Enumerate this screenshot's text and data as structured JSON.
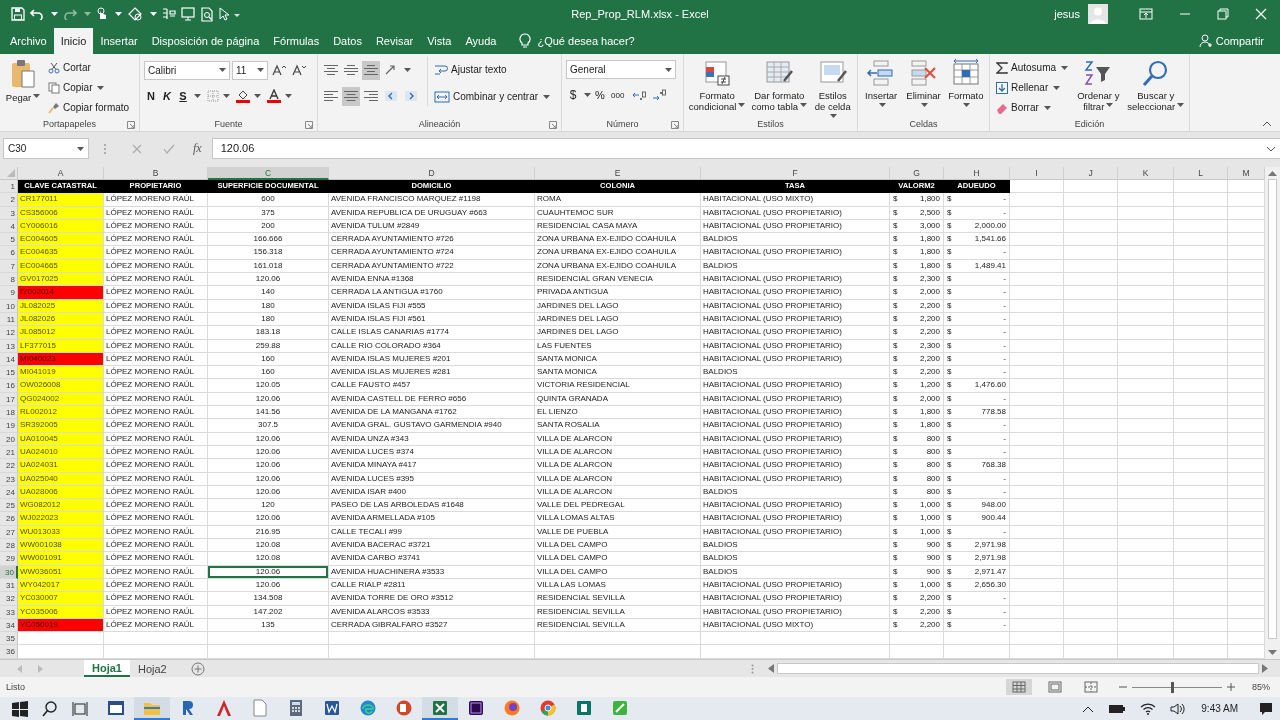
{
  "window": {
    "title": "Rep_Prop_RLM.xlsx  -  Excel",
    "user": "jesus"
  },
  "tabs": [
    {
      "label": "Archivo",
      "selected": false
    },
    {
      "label": "Inicio",
      "selected": true
    },
    {
      "label": "Insertar",
      "selected": false
    },
    {
      "label": "Disposición de página",
      "selected": false
    },
    {
      "label": "Fórmulas",
      "selected": false
    },
    {
      "label": "Datos",
      "selected": false
    },
    {
      "label": "Revisar",
      "selected": false
    },
    {
      "label": "Vista",
      "selected": false
    },
    {
      "label": "Ayuda",
      "selected": false
    }
  ],
  "tell_me": "¿Qué desea hacer?",
  "share": "Compartir",
  "ribbon": {
    "clipboard": {
      "label": "Portapapeles",
      "paste": "Pegar",
      "cut": "Cortar",
      "copy": "Copiar",
      "format_painter": "Copiar formato"
    },
    "font": {
      "label": "Fuente",
      "family": "Calibri",
      "size": "11",
      "bold": "N",
      "italic": "K",
      "underline": "S"
    },
    "alignment": {
      "label": "Alineación",
      "wrap": "Ajustar texto",
      "merge": "Combinar y centrar",
      "valign": [
        {
          "selected": false
        },
        {
          "selected": false
        },
        {
          "selected": true
        }
      ],
      "halign": [
        {
          "selected": false
        },
        {
          "selected": true
        },
        {
          "selected": false
        }
      ]
    },
    "number": {
      "label": "Número",
      "format": "General",
      "currency": "$",
      "percent": "%",
      "thousands": "000"
    },
    "styles": {
      "label": "Estilos",
      "conditional": "Formato condicional",
      "table": "Dar formato como tabla",
      "cell_styles": "Estilos de celda"
    },
    "cells": {
      "label": "Celdas",
      "insert": "Insertar",
      "delete": "Eliminar",
      "format": "Formato"
    },
    "editing": {
      "label": "Edición",
      "autosum": "Autosuma",
      "fill": "Rellenar",
      "clear": "Borrar",
      "sort": "Ordenar y filtrar",
      "find": "Buscar y seleccionar"
    }
  },
  "formula_bar": {
    "name_box": "C30",
    "function_label": "fx",
    "value": "120.06"
  },
  "sheet": {
    "columns": [
      {
        "label": "A",
        "selected": false
      },
      {
        "label": "B",
        "selected": false
      },
      {
        "label": "C",
        "selected": true
      },
      {
        "label": "D",
        "selected": false
      },
      {
        "label": "E",
        "selected": false
      },
      {
        "label": "F",
        "selected": false
      },
      {
        "label": "G",
        "selected": false
      },
      {
        "label": "H",
        "selected": false
      },
      {
        "label": "I",
        "selected": false
      },
      {
        "label": "J",
        "selected": false
      },
      {
        "label": "K",
        "selected": false
      },
      {
        "label": "L",
        "selected": false
      },
      {
        "label": "M",
        "selected": false
      }
    ],
    "header": {
      "n": "1",
      "cells": [
        "CLAVE CATASTRAL",
        "PROPIETARIO",
        "SUPERFICIE DOCUMENTAL",
        "DOMICILIO",
        "COLONIA",
        "TASA",
        "VALORM2",
        "ADUEUDO"
      ]
    },
    "rows": [
      {
        "n": "2",
        "color": "#ffff00",
        "selected": false,
        "cells": [
          "CR177011",
          "LÓPEZ MORENO RAÚL",
          "600",
          "AVENIDA FRANCISCO MARQUEZ #1198",
          "ROMA",
          "HABITACIONAL (USO MIXTO)"
        ],
        "valor": [
          "$",
          "1,800"
        ],
        "adeudo": [
          "$",
          "-"
        ]
      },
      {
        "n": "3",
        "color": "#ffff00",
        "selected": false,
        "cells": [
          "CS356006",
          "LÓPEZ MORENO RAÚL",
          "375",
          "AVENIDA REPUBLICA DE URUGUAY #663",
          "CUAUHTEMOC SUR",
          "HABITACIONAL (USO PROPIETARIO)"
        ],
        "valor": [
          "$",
          "2,500"
        ],
        "adeudo": [
          "$",
          "-"
        ]
      },
      {
        "n": "4",
        "color": "#ffff00",
        "selected": false,
        "cells": [
          "CY006016",
          "LÓPEZ MORENO RAÚL",
          "200",
          "AVENIDA TULUM #2849",
          "RESIDENCIAL CASA MAYA",
          "HABITACIONAL (USO PROPIETARIO)"
        ],
        "valor": [
          "$",
          "3,000"
        ],
        "adeudo": [
          "$",
          "2,000.00"
        ]
      },
      {
        "n": "5",
        "color": "#ffff00",
        "selected": false,
        "cells": [
          "EC004605",
          "LÓPEZ MORENO RAÚL",
          "166.666",
          "CERRADA AYUNTAMIENTO #726",
          "ZONA URBANA EX-EJIDO COAHUILA",
          "BALDIOS"
        ],
        "valor": [
          "$",
          "1,800"
        ],
        "adeudo": [
          "$",
          "1,541.66"
        ]
      },
      {
        "n": "6",
        "color": "#ffff00",
        "selected": false,
        "cells": [
          "EC004635",
          "LÓPEZ MORENO RAÚL",
          "156.318",
          "CERRADA AYUNTAMIENTO #724",
          "ZONA URBANA EX-EJIDO COAHUILA",
          "HABITACIONAL (USO PROPIETARIO)"
        ],
        "valor": [
          "$",
          "1,800"
        ],
        "adeudo": [
          "$",
          "-"
        ]
      },
      {
        "n": "7",
        "color": "#ffff00",
        "selected": false,
        "cells": [
          "EC004665",
          "LÓPEZ MORENO RAÚL",
          "161.018",
          "CERRADA AYUNTAMIENTO #722",
          "ZONA URBANA EX-EJIDO COAHUILA",
          "BALDIOS"
        ],
        "valor": [
          "$",
          "1,800"
        ],
        "adeudo": [
          "$",
          "1,489.41"
        ]
      },
      {
        "n": "8",
        "color": "#ffff00",
        "selected": false,
        "cells": [
          "GV017025",
          "LÓPEZ MORENO RAÚL",
          "120.06",
          "AVENIDA ENNA #1368",
          "RESIDENCIAL GRAN VENECIA",
          "HABITACIONAL (USO PROPIETARIO)"
        ],
        "valor": [
          "$",
          "2,300"
        ],
        "adeudo": [
          "$",
          "-"
        ]
      },
      {
        "n": "9",
        "color": "#ff0000",
        "selected": false,
        "cells": [
          "IY002014",
          "LÓPEZ MORENO RAÚL",
          "140",
          "CERRADA LA ANTIGUA #1760",
          "PRIVADA ANTIGUA",
          "HABITACIONAL (USO PROPIETARIO)"
        ],
        "valor": [
          "$",
          "2,000"
        ],
        "adeudo": [
          "$",
          "-"
        ]
      },
      {
        "n": "10",
        "color": "#ffff00",
        "selected": false,
        "cells": [
          "JL082025",
          "LÓPEZ MORENO RAÚL",
          "180",
          "AVENIDA ISLAS FIJI #555",
          "JARDINES DEL LAGO",
          "HABITACIONAL (USO PROPIETARIO)"
        ],
        "valor": [
          "$",
          "2,200"
        ],
        "adeudo": [
          "$",
          "-"
        ]
      },
      {
        "n": "11",
        "color": "#ffff00",
        "selected": false,
        "cells": [
          "JL082026",
          "LÓPEZ MORENO RAÚL",
          "180",
          "AVENIDA ISLAS FIJI #561",
          "JARDINES DEL LAGO",
          "HABITACIONAL (USO PROPIETARIO)"
        ],
        "valor": [
          "$",
          "2,200"
        ],
        "adeudo": [
          "$",
          "-"
        ]
      },
      {
        "n": "12",
        "color": "#ffff00",
        "selected": false,
        "cells": [
          "JL085012",
          "LÓPEZ MORENO RAÚL",
          "183.18",
          "CALLE ISLAS CANARIAS #1774",
          "JARDINES DEL LAGO",
          "HABITACIONAL (USO PROPIETARIO)"
        ],
        "valor": [
          "$",
          "2,200"
        ],
        "adeudo": [
          "$",
          "-"
        ]
      },
      {
        "n": "13",
        "color": "#ffff00",
        "selected": false,
        "cells": [
          "LF377015",
          "LÓPEZ MORENO RAÚL",
          "259.88",
          "CALLE RIO COLORADO #364",
          "LAS FUENTES",
          "HABITACIONAL (USO PROPIETARIO)"
        ],
        "valor": [
          "$",
          "2,300"
        ],
        "adeudo": [
          "$",
          "-"
        ]
      },
      {
        "n": "14",
        "color": "#ff0000",
        "selected": false,
        "cells": [
          "MI040023",
          "LÓPEZ MORENO RAÚL",
          "160",
          "AVENIDA ISLAS MUJERES #201",
          "SANTA MONICA",
          "HABITACIONAL (USO PROPIETARIO)"
        ],
        "valor": [
          "$",
          "2,200"
        ],
        "adeudo": [
          "$",
          "-"
        ]
      },
      {
        "n": "15",
        "color": "#ffff00",
        "selected": false,
        "cells": [
          "MI041019",
          "LÓPEZ MORENO RAÚL",
          "160",
          "AVENIDA ISLAS MUJERES #281",
          "SANTA MONICA",
          "BALDIOS"
        ],
        "valor": [
          "$",
          "2,200"
        ],
        "adeudo": [
          "$",
          "-"
        ]
      },
      {
        "n": "16",
        "color": "#ffff00",
        "selected": false,
        "cells": [
          "OW026008",
          "LÓPEZ MORENO RAÚL",
          "120.05",
          "CALLE FAUSTO #457",
          "VICTORIA RESIDENCIAL",
          "HABITACIONAL (USO PROPIETARIO)"
        ],
        "valor": [
          "$",
          "1,200"
        ],
        "adeudo": [
          "$",
          "1,476.60"
        ]
      },
      {
        "n": "17",
        "color": "#ffff00",
        "selected": false,
        "cells": [
          "QG024002",
          "LÓPEZ MORENO RAÚL",
          "120.06",
          "AVENIDA CASTELL DE FERRO #656",
          "QUINTA GRANADA",
          "HABITACIONAL (USO PROPIETARIO)"
        ],
        "valor": [
          "$",
          "2,000"
        ],
        "adeudo": [
          "$",
          "-"
        ]
      },
      {
        "n": "18",
        "color": "#ffff00",
        "selected": false,
        "cells": [
          "RL002012",
          "LÓPEZ MORENO RAÚL",
          "141.56",
          "AVENIDA DE LA MANGANA #1762",
          "EL LIENZO",
          "HABITACIONAL (USO PROPIETARIO)"
        ],
        "valor": [
          "$",
          "1,800"
        ],
        "adeudo": [
          "$",
          "778.58"
        ]
      },
      {
        "n": "19",
        "color": "#ffff00",
        "selected": false,
        "cells": [
          "SR392005",
          "LÓPEZ MORENO RAÚL",
          "307.5",
          "AVENIDA GRAL. GUSTAVO GARMENDIA #940",
          "SANTA ROSALIA",
          "HABITACIONAL (USO PROPIETARIO)"
        ],
        "valor": [
          "$",
          "1,800"
        ],
        "adeudo": [
          "$",
          "-"
        ]
      },
      {
        "n": "20",
        "color": "#ffff00",
        "selected": false,
        "cells": [
          "UA010045",
          "LÓPEZ MORENO RAÚL",
          "120.06",
          "AVENIDA UNZA #343",
          "VILLA DE ALARCON",
          "HABITACIONAL (USO PROPIETARIO)"
        ],
        "valor": [
          "$",
          "800"
        ],
        "adeudo": [
          "$",
          "-"
        ]
      },
      {
        "n": "21",
        "color": "#ffff00",
        "selected": false,
        "cells": [
          "UA024010",
          "LÓPEZ MORENO RAÚL",
          "120.06",
          "AVENIDA LUCES #374",
          "VILLA DE ALARCON",
          "HABITACIONAL (USO PROPIETARIO)"
        ],
        "valor": [
          "$",
          "800"
        ],
        "adeudo": [
          "$",
          "-"
        ]
      },
      {
        "n": "22",
        "color": "#ffff00",
        "selected": false,
        "cells": [
          "UA024031",
          "LÓPEZ MORENO RAÚL",
          "120.06",
          "AVENIDA MINAYA #417",
          "VILLA DE ALARCON",
          "HABITACIONAL (USO PROPIETARIO)"
        ],
        "valor": [
          "$",
          "800"
        ],
        "adeudo": [
          "$",
          "768.38"
        ]
      },
      {
        "n": "23",
        "color": "#ffff00",
        "selected": false,
        "cells": [
          "UA025040",
          "LÓPEZ MORENO RAÚL",
          "120.06",
          "AVENIDA LUCES #395",
          "VILLA DE ALARCON",
          "HABITACIONAL (USO PROPIETARIO)"
        ],
        "valor": [
          "$",
          "800"
        ],
        "adeudo": [
          "$",
          "-"
        ]
      },
      {
        "n": "24",
        "color": "#ffff00",
        "selected": false,
        "cells": [
          "UA028006",
          "LÓPEZ MORENO RAÚL",
          "120.06",
          "AVENIDA ISAR #400",
          "VILLA DE ALARCON",
          "BALDIOS"
        ],
        "valor": [
          "$",
          "800"
        ],
        "adeudo": [
          "$",
          "-"
        ]
      },
      {
        "n": "25",
        "color": "#ffff00",
        "selected": false,
        "cells": [
          "WG082012",
          "LÓPEZ MORENO RAÚL",
          "120",
          "PASEO DE LAS ARBOLEDAS #1648",
          "VALLE DEL PEDREGAL",
          "HABITACIONAL (USO PROPIETARIO)"
        ],
        "valor": [
          "$",
          "1,000"
        ],
        "adeudo": [
          "$",
          "948.00"
        ]
      },
      {
        "n": "26",
        "color": "#ffff00",
        "selected": false,
        "cells": [
          "WJ022023",
          "LÓPEZ MORENO RAÚL",
          "120.06",
          "AVENIDA ARMELLADA #105",
          "VILLA LOMAS ALTAS",
          "HABITACIONAL (USO PROPIETARIO)"
        ],
        "valor": [
          "$",
          "1,000"
        ],
        "adeudo": [
          "$",
          "900.44"
        ]
      },
      {
        "n": "27",
        "color": "#ffff00",
        "selected": false,
        "cells": [
          "WU013033",
          "LÓPEZ MORENO RAÚL",
          "216.95",
          "CALLE TECALI #99",
          "VALLE DE PUEBLA",
          "HABITACIONAL (USO PROPIETARIO)"
        ],
        "valor": [
          "$",
          "1,000"
        ],
        "adeudo": [
          "$",
          "-"
        ]
      },
      {
        "n": "28",
        "color": "#ffff00",
        "selected": false,
        "cells": [
          "WW001038",
          "LÓPEZ MORENO RAÚL",
          "120.08",
          "AVENIDA BACERAC #3721",
          "VILLA DEL CAMPO",
          "BALDIOS"
        ],
        "valor": [
          "$",
          "900"
        ],
        "adeudo": [
          "$",
          "2,971.98"
        ]
      },
      {
        "n": "29",
        "color": "#ffff00",
        "selected": false,
        "cells": [
          "WW001091",
          "LÓPEZ MORENO RAÚL",
          "120.08",
          "AVENIDA CARBO #3741",
          "VILLA DEL CAMPO",
          "BALDIOS"
        ],
        "valor": [
          "$",
          "900"
        ],
        "adeudo": [
          "$",
          "2,971.98"
        ]
      },
      {
        "n": "30",
        "color": "#ffff00",
        "selected": true,
        "cells": [
          "WW036051",
          "LÓPEZ MORENO RAÚL",
          "120.06",
          "AVENIDA HUACHINERA #3533",
          "VILLA DEL CAMPO",
          "BALDIOS"
        ],
        "valor": [
          "$",
          "900"
        ],
        "adeudo": [
          "$",
          "2,971.47"
        ]
      },
      {
        "n": "31",
        "color": "#ffff00",
        "selected": false,
        "cells": [
          "WY042017",
          "LÓPEZ MORENO RAÚL",
          "120.06",
          "CALLE RIALP #2811",
          "VILLA LAS LOMAS",
          "HABITACIONAL (USO PROPIETARIO)"
        ],
        "valor": [
          "$",
          "1,000"
        ],
        "adeudo": [
          "$",
          "2,656.30"
        ]
      },
      {
        "n": "32",
        "color": "#ffff00",
        "selected": false,
        "cells": [
          "YC030007",
          "LÓPEZ MORENO RAÚL",
          "134.508",
          "AVENIDA TORRE DE ORO #3512",
          "RESIDENCIAL SEVILLA",
          "HABITACIONAL (USO PROPIETARIO)"
        ],
        "valor": [
          "$",
          "2,200"
        ],
        "adeudo": [
          "$",
          "-"
        ]
      },
      {
        "n": "33",
        "color": "#ffff00",
        "selected": false,
        "cells": [
          "YC035006",
          "LÓPEZ MORENO RAÚL",
          "147.202",
          "AVENIDA ALARCOS #3533",
          "RESIDENCIAL SEVILLA",
          "HABITACIONAL (USO PROPIETARIO)"
        ],
        "valor": [
          "$",
          "2,200"
        ],
        "adeudo": [
          "$",
          "-"
        ]
      },
      {
        "n": "34",
        "color": "#ff0000",
        "selected": false,
        "cells": [
          "YC050019",
          "LÓPEZ MORENO RAÚL",
          "135",
          "CERRADA GIBRALFARO #3527",
          "RESIDENCIAL SEVILLA",
          "HABITACIONAL (USO MIXTO)"
        ],
        "valor": [
          "$",
          "2,200"
        ],
        "adeudo": [
          "$",
          "-"
        ]
      }
    ],
    "empty_rows": [
      "35",
      "36"
    ]
  },
  "sheet_tabs": [
    {
      "label": "Hoja1",
      "selected": true
    },
    {
      "label": "Hoja2",
      "selected": false
    }
  ],
  "status_bar": {
    "text": "Listo",
    "views": [
      {
        "selected": true
      },
      {
        "selected": false
      },
      {
        "selected": false
      }
    ],
    "zoom": {
      "level": 0.45
    },
    "zoom_label": "85%"
  },
  "taskbar": {
    "apps": [
      {
        "running": false
      },
      {
        "running": true
      },
      {
        "running": false
      },
      {
        "running": false
      },
      {
        "running": false
      },
      {
        "running": false
      },
      {
        "running": false
      },
      {
        "running": false
      },
      {
        "running": false
      },
      {
        "running": true
      },
      {
        "running": false
      },
      {
        "running": false
      },
      {
        "running": false
      },
      {
        "running": false
      },
      {
        "running": false
      }
    ],
    "time": "9:43 AM"
  }
}
